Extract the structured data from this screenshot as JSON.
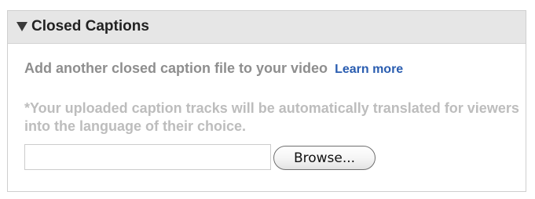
{
  "panel": {
    "title": "Closed Captions",
    "expanded": true,
    "toggle_icon": "triangle-down-icon"
  },
  "intro": {
    "text": "Add another closed caption file to your video",
    "link_label": "Learn more",
    "link_color": "#2a5db0"
  },
  "note": {
    "text": "*Your uploaded caption tracks will be automatically translated for viewers into the language of their choice."
  },
  "file_input": {
    "value": "",
    "placeholder": "",
    "browse_label": "Browse..."
  }
}
